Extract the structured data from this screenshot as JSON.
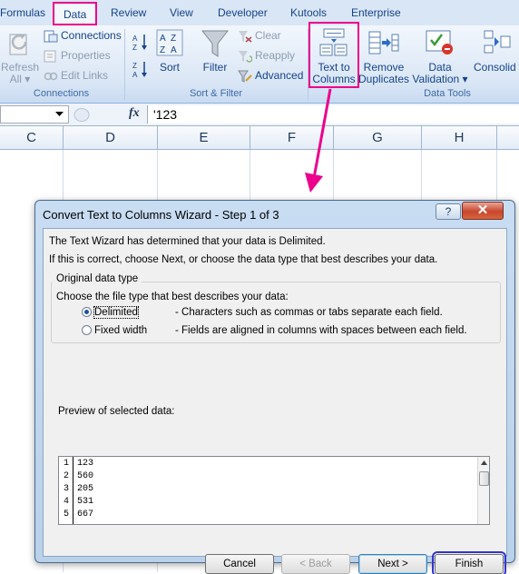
{
  "ribbon_tabs": [
    "Formulas",
    "Data",
    "Review",
    "View",
    "Developer",
    "Kutools",
    "Enterprise"
  ],
  "connections_group": {
    "refresh_all_line1": "Refresh",
    "refresh_all_line2": "All ▾",
    "connections": "Connections",
    "properties": "Properties",
    "edit_links": "Edit Links",
    "label": "Connections"
  },
  "sort_filter_group": {
    "sort": "Sort",
    "filter": "Filter",
    "clear": "Clear",
    "reapply": "Reapply",
    "advanced": "Advanced",
    "label": "Sort & Filter"
  },
  "data_tools_group": {
    "text_to_columns_line1": "Text to",
    "text_to_columns_line2": "Columns",
    "remove_duplicates_line1": "Remove",
    "remove_duplicates_line2": "Duplicates",
    "data_validation_line1": "Data",
    "data_validation_line2": "Validation ▾",
    "consolidate": "Consolid",
    "label": "Data Tools"
  },
  "formula_bar": {
    "fx": "fx",
    "value": "'123"
  },
  "columns": [
    "C",
    "D",
    "E",
    "F",
    "G",
    "H"
  ],
  "dialog": {
    "title": "Convert Text to Columns Wizard - Step 1 of 3",
    "help": "?",
    "close": "✕",
    "line1": "The Text Wizard has determined that your data is Delimited.",
    "line2": "If this is correct, choose Next, or choose the data type that best describes your data.",
    "group_title": "Original data type",
    "choose_label": "Choose the file type that best describes your data:",
    "options": [
      {
        "label": "Delimited",
        "desc": "- Characters such as commas or tabs separate each field.",
        "checked": true
      },
      {
        "label": "Fixed width",
        "desc": "- Fields are aligned in columns with spaces between each field.",
        "checked": false
      }
    ],
    "preview_label": "Preview of selected data:",
    "preview_rows": [
      {
        "n": "1",
        "v": "123"
      },
      {
        "n": "2",
        "v": "560"
      },
      {
        "n": "3",
        "v": "205"
      },
      {
        "n": "4",
        "v": "531"
      },
      {
        "n": "5",
        "v": "667"
      }
    ],
    "buttons": {
      "cancel": "Cancel",
      "back": "< Back",
      "next": "Next >",
      "finish": "Finish"
    }
  },
  "colors": {
    "highlight": "#ec008c",
    "finish_outline": "#3333cc"
  }
}
